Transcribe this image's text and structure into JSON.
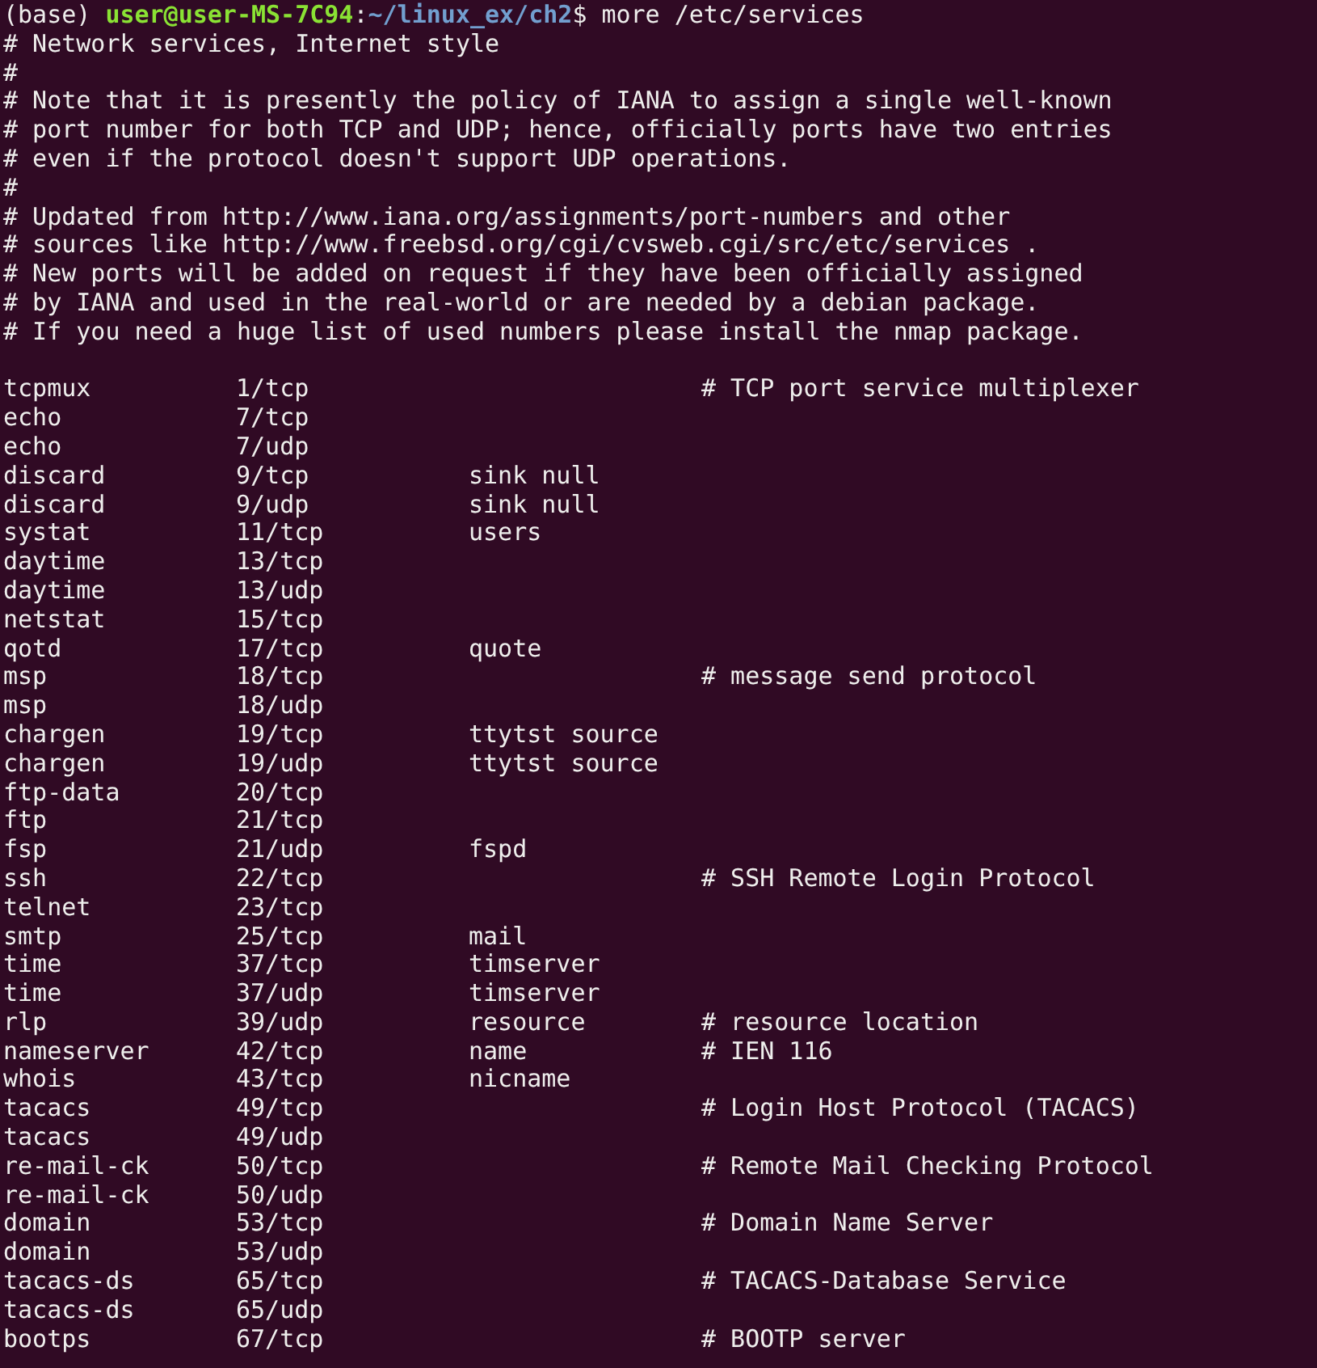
{
  "prompt": {
    "env": "(base)",
    "user_host": "user@user-MS-7C94",
    "separator": ":",
    "path": "~/linux_ex/ch2",
    "symbol": "$",
    "command": "more /etc/services"
  },
  "header_comments": [
    "# Network services, Internet style",
    "#",
    "# Note that it is presently the policy of IANA to assign a single well-known",
    "# port number for both TCP and UDP; hence, officially ports have two entries",
    "# even if the protocol doesn't support UDP operations.",
    "#",
    "# Updated from http://www.iana.org/assignments/port-numbers and other",
    "# sources like http://www.freebsd.org/cgi/cvsweb.cgi/src/etc/services .",
    "# New ports will be added on request if they have been officially assigned",
    "# by IANA and used in the real-world or are needed by a debian package.",
    "# If you need a huge list of used numbers please install the nmap package."
  ],
  "services": [
    {
      "name": "tcpmux",
      "port": "1/tcp",
      "comment": "# TCP port service multiplexer"
    },
    {
      "name": "echo",
      "port": "7/tcp"
    },
    {
      "name": "echo",
      "port": "7/udp"
    },
    {
      "name": "discard",
      "port": "9/tcp",
      "aliases": "sink null"
    },
    {
      "name": "discard",
      "port": "9/udp",
      "aliases": "sink null"
    },
    {
      "name": "systat",
      "port": "11/tcp",
      "aliases": "users"
    },
    {
      "name": "daytime",
      "port": "13/tcp"
    },
    {
      "name": "daytime",
      "port": "13/udp"
    },
    {
      "name": "netstat",
      "port": "15/tcp"
    },
    {
      "name": "qotd",
      "port": "17/tcp",
      "aliases": "quote"
    },
    {
      "name": "msp",
      "port": "18/tcp",
      "comment": "# message send protocol"
    },
    {
      "name": "msp",
      "port": "18/udp"
    },
    {
      "name": "chargen",
      "port": "19/tcp",
      "aliases": "ttytst source"
    },
    {
      "name": "chargen",
      "port": "19/udp",
      "aliases": "ttytst source"
    },
    {
      "name": "ftp-data",
      "port": "20/tcp"
    },
    {
      "name": "ftp",
      "port": "21/tcp"
    },
    {
      "name": "fsp",
      "port": "21/udp",
      "aliases": "fspd"
    },
    {
      "name": "ssh",
      "port": "22/tcp",
      "comment": "# SSH Remote Login Protocol"
    },
    {
      "name": "telnet",
      "port": "23/tcp"
    },
    {
      "name": "smtp",
      "port": "25/tcp",
      "aliases": "mail"
    },
    {
      "name": "time",
      "port": "37/tcp",
      "aliases": "timserver"
    },
    {
      "name": "time",
      "port": "37/udp",
      "aliases": "timserver"
    },
    {
      "name": "rlp",
      "port": "39/udp",
      "aliases": "resource",
      "comment": "# resource location"
    },
    {
      "name": "nameserver",
      "port": "42/tcp",
      "aliases": "name",
      "comment": "# IEN 116"
    },
    {
      "name": "whois",
      "port": "43/tcp",
      "aliases": "nicname"
    },
    {
      "name": "tacacs",
      "port": "49/tcp",
      "comment": "# Login Host Protocol (TACACS)"
    },
    {
      "name": "tacacs",
      "port": "49/udp"
    },
    {
      "name": "re-mail-ck",
      "port": "50/tcp",
      "comment": "# Remote Mail Checking Protocol"
    },
    {
      "name": "re-mail-ck",
      "port": "50/udp"
    },
    {
      "name": "domain",
      "port": "53/tcp",
      "comment": "# Domain Name Server"
    },
    {
      "name": "domain",
      "port": "53/udp"
    },
    {
      "name": "tacacs-ds",
      "port": "65/tcp",
      "comment": "# TACACS-Database Service"
    },
    {
      "name": "tacacs-ds",
      "port": "65/udp"
    },
    {
      "name": "bootps",
      "port": "67/tcp",
      "comment": "# BOOTP server"
    }
  ]
}
